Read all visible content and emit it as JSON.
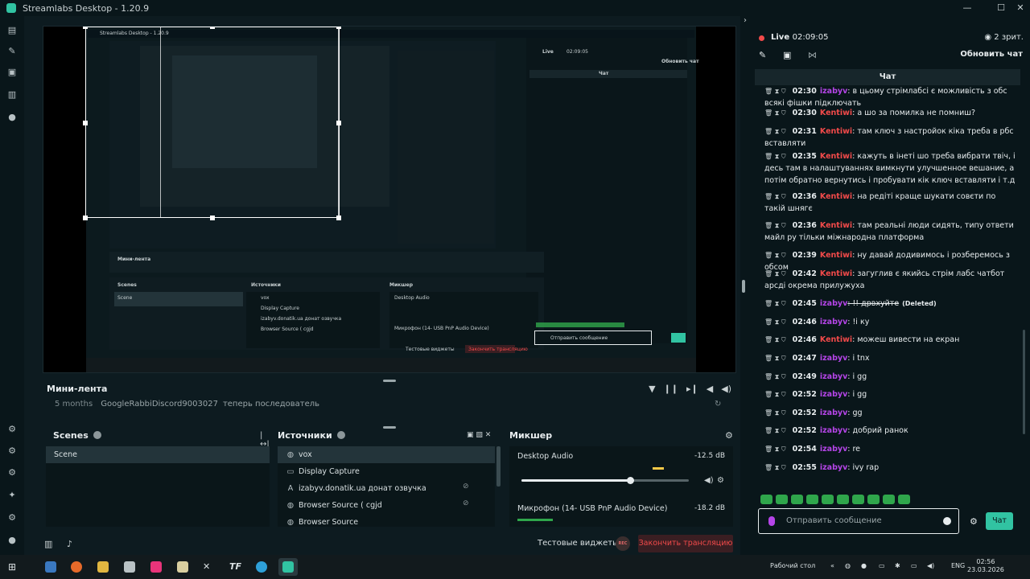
{
  "app": {
    "title": "Streamlabs Desktop - 1.20.9"
  },
  "window_controls": {
    "minimize": "—",
    "maximize": "☐",
    "close": "✕"
  },
  "colors": {
    "accent": "#31c3a2",
    "live": "#f24a4a",
    "user_red": "#f24a4a",
    "user_purple": "#b545e8"
  },
  "nav_icons": [
    "editor-icon",
    "themes-icon",
    "store-icon",
    "layouts-icon",
    "play-icon"
  ],
  "nav_icons_bottom": [
    "highlighter-icon",
    "tools-icon",
    "apps-icon",
    "ai-icon",
    "settings-icon",
    "profile-icon"
  ],
  "mini_feed": {
    "title": "Мини-лента",
    "rows": [
      {
        "time": "5 months",
        "user": "GoogleRabbiDiscord9003027",
        "action": "теперь последователь"
      }
    ]
  },
  "scenes": {
    "title": "Scenes",
    "items": [
      "Scene"
    ]
  },
  "sources": {
    "title": "Источники",
    "items": [
      {
        "icon": "globe-icon",
        "label": "vox"
      },
      {
        "icon": "monitor-icon",
        "label": "Display Capture"
      },
      {
        "icon": "text-icon",
        "label": "izabyv.donatik.ua донат озвучка"
      },
      {
        "icon": "globe-icon",
        "label": "Browser Source ( cgjd"
      },
      {
        "icon": "globe-icon",
        "label": "Browser Source"
      }
    ]
  },
  "mixer": {
    "title": "Микшер",
    "channels": [
      {
        "name": "Desktop Audio",
        "db": "-12.5 dB",
        "level": 0.65
      },
      {
        "name": "Микрофон (14- USB PnP Audio Device)",
        "db": "-18.2 dB",
        "level": 0.2
      }
    ]
  },
  "bottom": {
    "test_widgets": "Тестовые виджеты",
    "rec": "REC",
    "end_stream": "Закончить трансляцию"
  },
  "chat": {
    "live_label": "Live",
    "live_time": "02:09:05",
    "viewers": "2 зрит.",
    "refresh": "Обновить чат",
    "title": "Чат",
    "input_placeholder": "Отправить сообщение",
    "send": "Чат",
    "messages": [
      {
        "time": "02:30",
        "user": "izabyv",
        "type": "purple",
        "text": ": в цьому стрімлабсі є можливість з обс всякі фішки підключать"
      },
      {
        "time": "02:30",
        "user": "Kentiwi",
        "type": "red",
        "text": ": а шо за помилка не помниш?"
      },
      {
        "time": "02:31",
        "user": "Kentiwi",
        "type": "red",
        "text": ": там ключ з настройок кіка треба в рбс вставляти"
      },
      {
        "time": "02:35",
        "user": "Kentiwi",
        "type": "red",
        "text": ": кажуть в інеті шо треба вибрати твіч, і десь там в налаштуваннях вимкнути улучшенное вешание, а потім обратно вернутись і пробувати кік ключ вставляти і т.д"
      },
      {
        "time": "02:36",
        "user": "Kentiwi",
        "type": "red",
        "text": ": на редіті краще шукати совєти по такій шнягє"
      },
      {
        "time": "02:36",
        "user": "Kentiwi",
        "type": "red",
        "text": ": там реальні люди сидять, типу ответи майл ру тільки міжнародна платформа"
      },
      {
        "time": "02:39",
        "user": "Kentiwi",
        "type": "red",
        "text": ": ну давай додивимось і розберемось з обсом"
      },
      {
        "time": "02:42",
        "user": "Kentiwi",
        "type": "red",
        "text": ": загуглив є якийсь стрім лабс чатбот арсді окрема прилужуха"
      },
      {
        "time": "02:45",
        "user": "izabyv",
        "type": "purple",
        "text": ": !! дрвхуйте",
        "deleted": "(Deleted)"
      },
      {
        "time": "02:46",
        "user": "izabyv",
        "type": "purple",
        "text": ": !і ку"
      },
      {
        "time": "02:46",
        "user": "Kentiwi",
        "type": "red",
        "text": ": можеш вивести на екран"
      },
      {
        "time": "02:47",
        "user": "izabyv",
        "type": "purple",
        "text": ": i tnx"
      },
      {
        "time": "02:49",
        "user": "izabyv",
        "type": "purple",
        "text": ": i gg"
      },
      {
        "time": "02:52",
        "user": "izabyv",
        "type": "purple",
        "text": ": i gg"
      },
      {
        "time": "02:52",
        "user": "izabyv",
        "type": "purple",
        "text": ": gg"
      },
      {
        "time": "02:52",
        "user": "izabyv",
        "type": "purple",
        "text": ": добрий ранок"
      },
      {
        "time": "02:54",
        "user": "izabyv",
        "type": "purple",
        "text": ": re"
      },
      {
        "time": "02:55",
        "user": "izabyv",
        "type": "purple",
        "text": ": ivy rap"
      }
    ]
  },
  "taskbar": {
    "desktop_label": "Рабочий стол",
    "lang": "ENG",
    "time": "02:56",
    "date": "23.03.2026"
  }
}
